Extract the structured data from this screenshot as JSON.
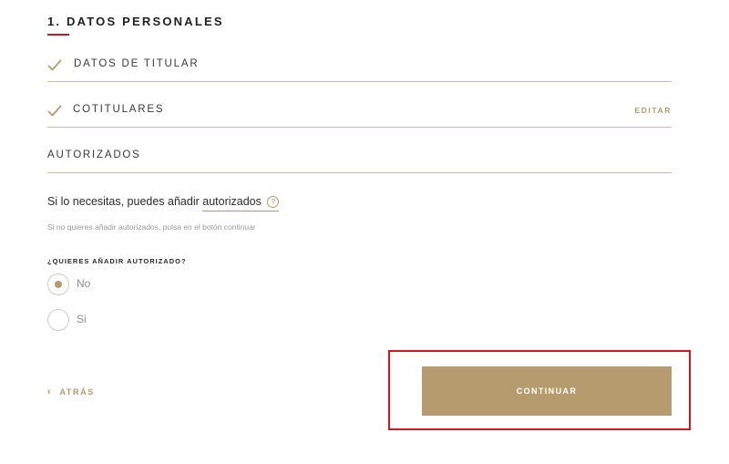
{
  "section": {
    "title": "1. DATOS PERSONALES"
  },
  "steps": [
    {
      "label": "DATOS DE TITULAR",
      "completed": true,
      "action": ""
    },
    {
      "label": "COTITULARES",
      "completed": true,
      "action": "EDITAR"
    },
    {
      "label": "AUTORIZADOS",
      "completed": false,
      "action": ""
    }
  ],
  "info": {
    "prefix": "Si lo necesitas, puedes añadir ",
    "link": "autorizados",
    "help_icon": "?",
    "sub": "Si no quieres añadir autorizados, pulsa en el botón continuar"
  },
  "question": {
    "label": "¿QUIERES AÑADIR AUTORIZADO?",
    "options": [
      {
        "label": "No",
        "selected": true
      },
      {
        "label": "Si",
        "selected": false
      }
    ]
  },
  "nav": {
    "back_icon": "‹",
    "back_label": "ATRÁS",
    "continue_label": "CONTINUAR"
  },
  "colors": {
    "accent": "#b69b6f",
    "title_underline": "#b3202a",
    "highlight": "#d2161e"
  }
}
